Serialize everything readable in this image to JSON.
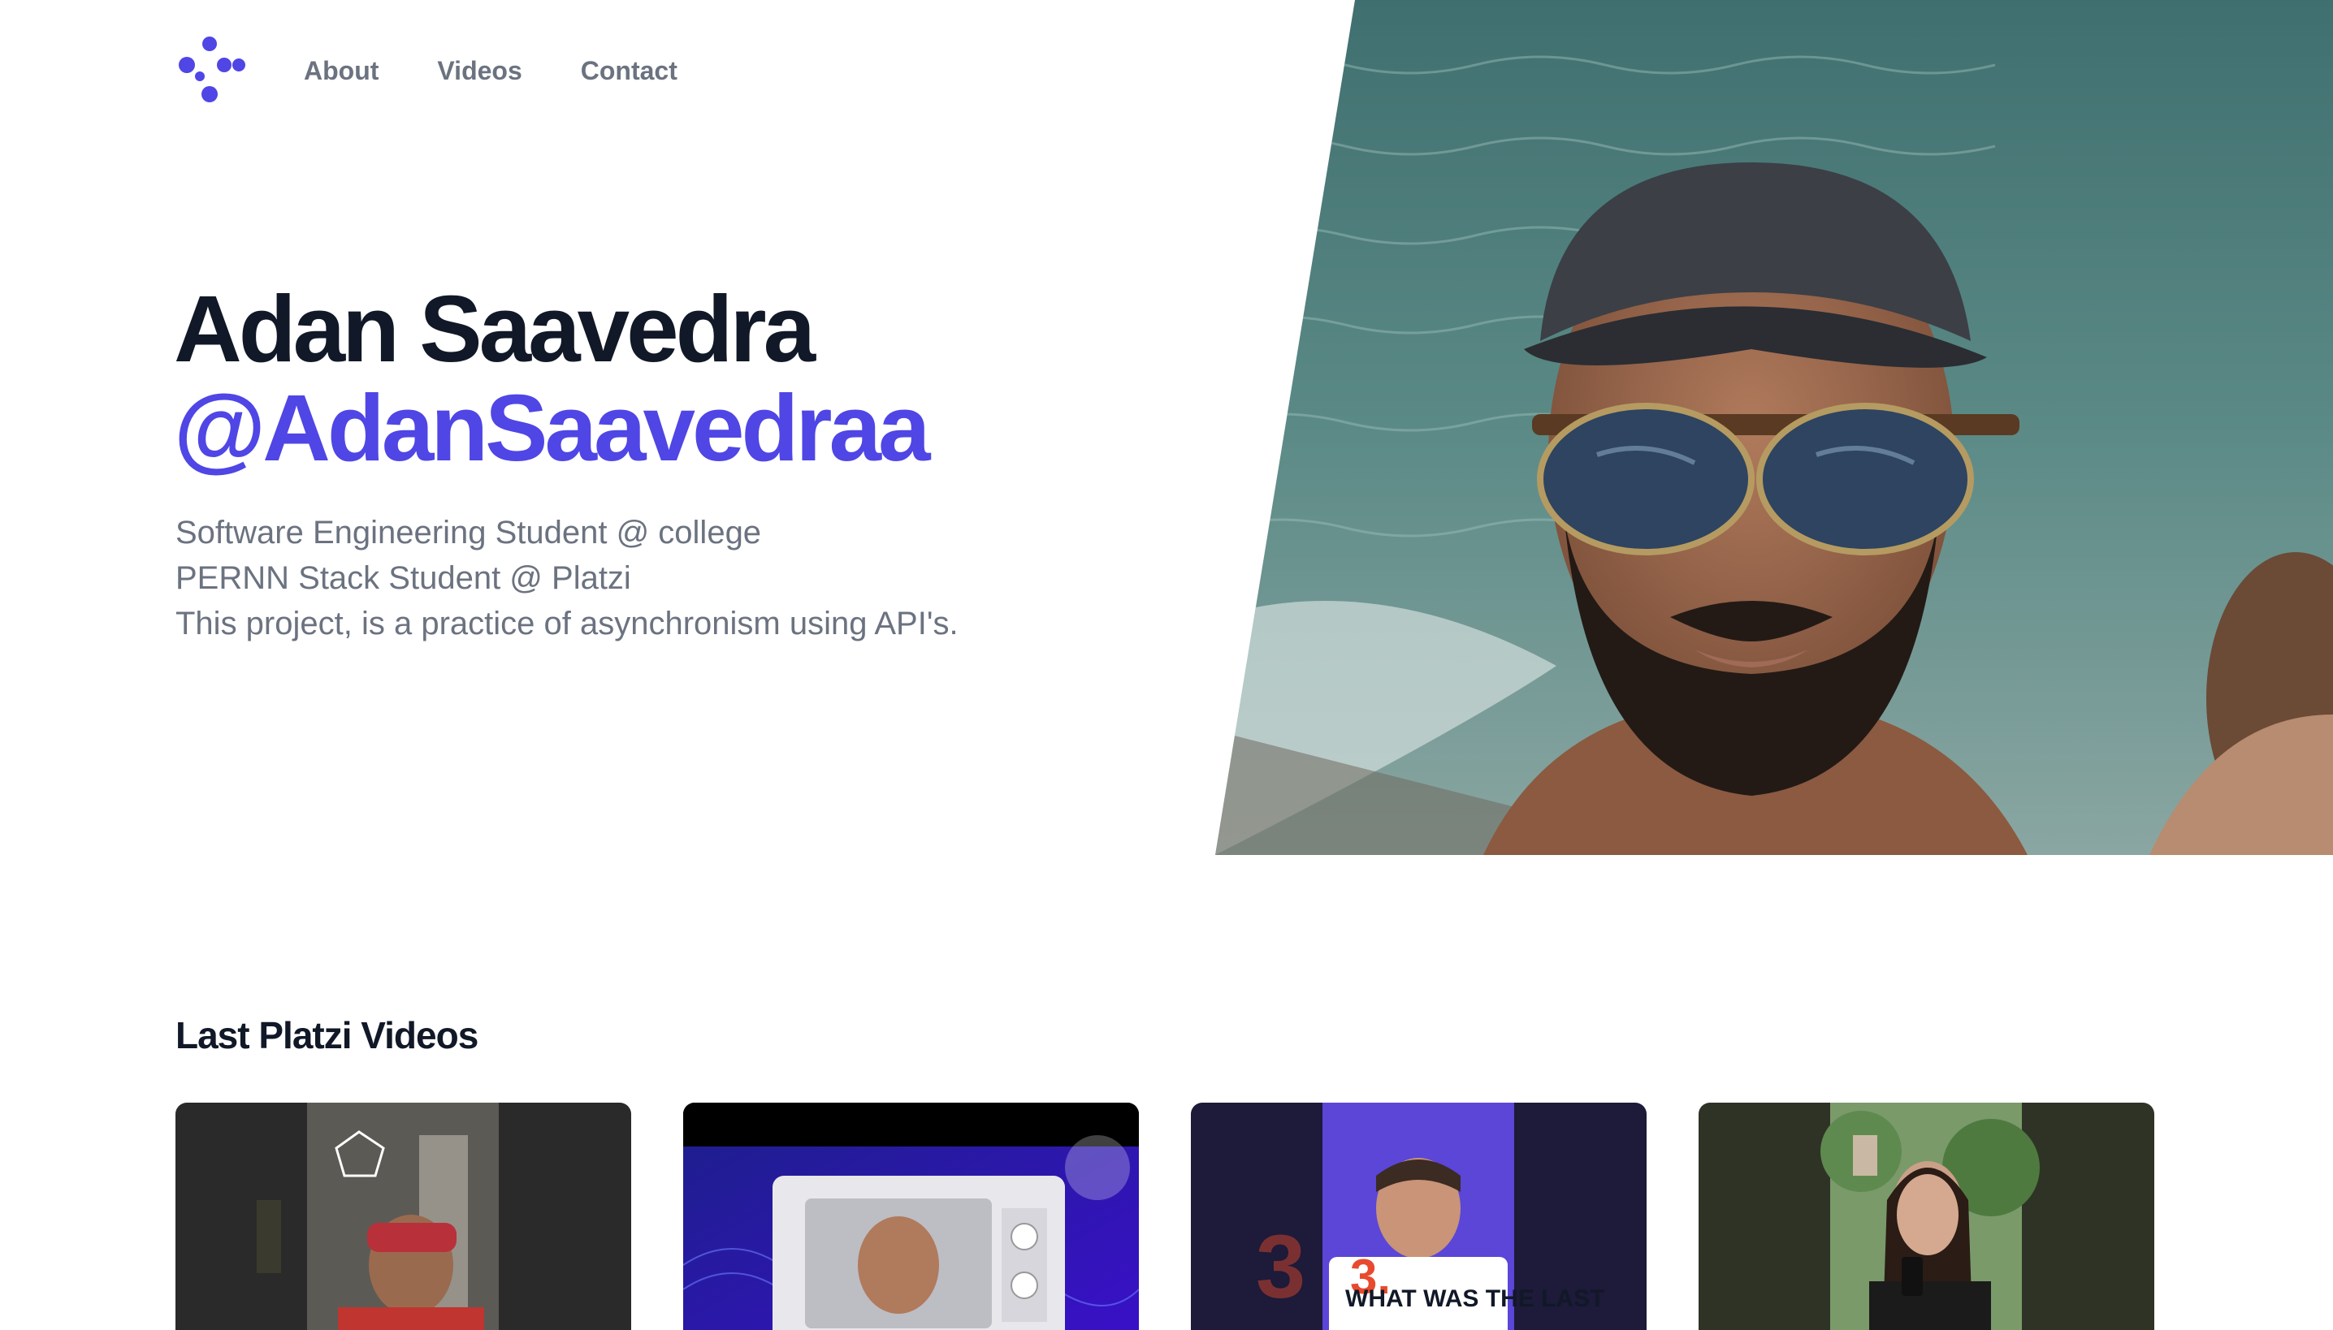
{
  "nav": {
    "logo_icon": "dots-logo-icon",
    "links": [
      {
        "label": "About"
      },
      {
        "label": "Videos"
      },
      {
        "label": "Contact"
      }
    ]
  },
  "hero": {
    "name": "Adan Saavedra",
    "handle": "@AdanSaavedraa",
    "bio": [
      "Software Engineering Student @ college",
      "PERNN Stack Student @ Platzi",
      "This project, is a practice of asynchronism using API's."
    ]
  },
  "videos": {
    "section_title": "Last Platzi Videos",
    "cards": [
      {
        "thumb": "person-pentagon-thumb"
      },
      {
        "thumb": "person-microwave-thumb"
      },
      {
        "thumb": "person-sign-thumb",
        "sign_number": "3.",
        "sign_text": "What was the last"
      },
      {
        "thumb": "person-phone-thumb"
      }
    ]
  },
  "colors": {
    "accent": "#4f46e5",
    "heading": "#111827",
    "muted": "#6b7280"
  }
}
